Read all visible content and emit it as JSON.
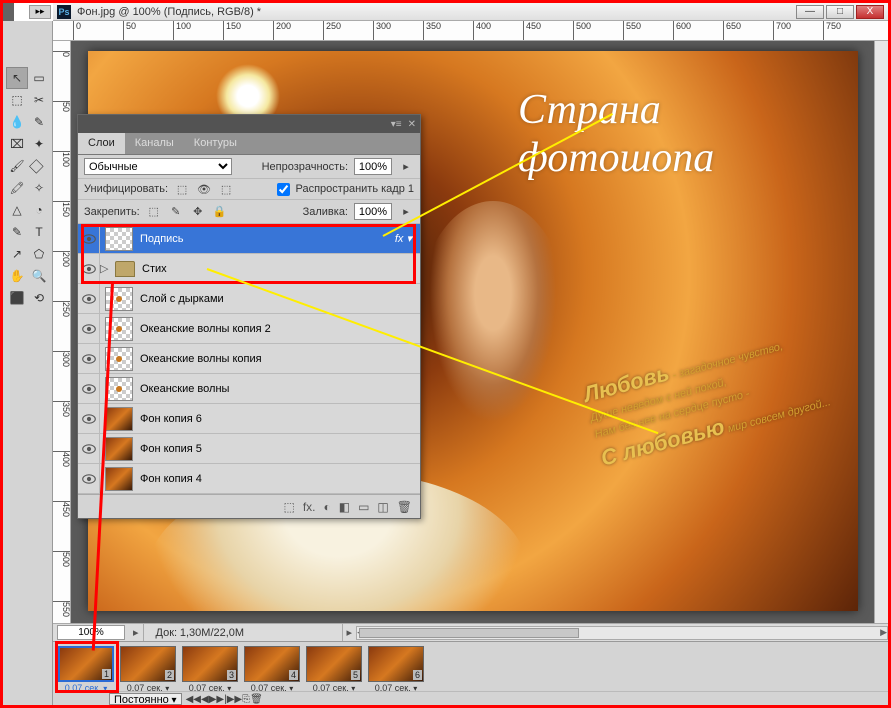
{
  "window": {
    "title": "Фон.jpg @ 100% (Подпись, RGB/8) *",
    "minimize": "—",
    "maximize": "□",
    "close": "X"
  },
  "ruler_h": [
    "0",
    "50",
    "100",
    "150",
    "200",
    "250",
    "300",
    "350",
    "400",
    "450",
    "500",
    "550",
    "600",
    "650",
    "700",
    "750"
  ],
  "ruler_v": [
    "0",
    "50",
    "100",
    "150",
    "200",
    "250",
    "300",
    "350",
    "400",
    "450",
    "500",
    "550"
  ],
  "canvas": {
    "script_title": "Страна фотошопа",
    "poem_line1_big": "Любовь",
    "poem_line1": " - загадочное чувство,",
    "poem_line2": "Душе неведом с ней покой,",
    "poem_line3": "Нам без нее на сердце пусто -",
    "poem_line4_big": "С любовью",
    "poem_line4": " мир совсем другой..."
  },
  "layers_panel": {
    "tabs": {
      "layers": "Слои",
      "channels": "Каналы",
      "paths": "Контуры"
    },
    "blend_mode": "Обычные",
    "opacity_label": "Непрозрачность:",
    "opacity_value": "100%",
    "unify_label": "Унифицировать:",
    "propagate_label": "Распространить кадр 1",
    "lock_label": "Закрепить:",
    "fill_label": "Заливка:",
    "fill_value": "100%",
    "layers": [
      {
        "name": "Подпись",
        "selected": true,
        "fx": "fx",
        "thumb": "checker"
      },
      {
        "name": "Стих",
        "folder": true
      },
      {
        "name": "Слой с дырками",
        "thumb": "checker-dot"
      },
      {
        "name": "Океанские волны копия 2",
        "thumb": "checker-dot"
      },
      {
        "name": "Океанские волны копия",
        "thumb": "checker-dot"
      },
      {
        "name": "Океанские волны",
        "thumb": "checker-dot"
      },
      {
        "name": "Фон копия 6",
        "thumb": "img"
      },
      {
        "name": "Фон копия 5",
        "thumb": "img"
      },
      {
        "name": "Фон копия 4",
        "thumb": "img"
      }
    ],
    "footer_icons": [
      "⬚",
      "fx.",
      "◐",
      "◧",
      "▭",
      "◫",
      "🗑"
    ]
  },
  "bottom": {
    "zoom": "100%",
    "doc_label": "Док:",
    "doc_info": "1,30M/22,0M"
  },
  "animation": {
    "frames": [
      {
        "num": "1",
        "time": "0,07 сек.",
        "selected": true
      },
      {
        "num": "2",
        "time": "0,07 сек."
      },
      {
        "num": "3",
        "time": "0,07 сек."
      },
      {
        "num": "4",
        "time": "0,07 сек."
      },
      {
        "num": "5",
        "time": "0,07 сек."
      },
      {
        "num": "6",
        "time": "0,07 сек."
      }
    ],
    "loop": "Постоянно",
    "controls": [
      "◀◀",
      "◀",
      "▶",
      "▶|",
      "▶▶",
      "⎘",
      "🗑"
    ]
  },
  "tools": [
    "↖",
    "▭",
    "⬚",
    "✂",
    "💧",
    "✎",
    "⌧",
    "✦",
    "🖌",
    "⃟",
    "🖍",
    "✧",
    "△",
    "◔",
    "✎",
    "T",
    "↗",
    "⬠",
    "✋",
    "🔍",
    "⬛",
    "⟲"
  ]
}
